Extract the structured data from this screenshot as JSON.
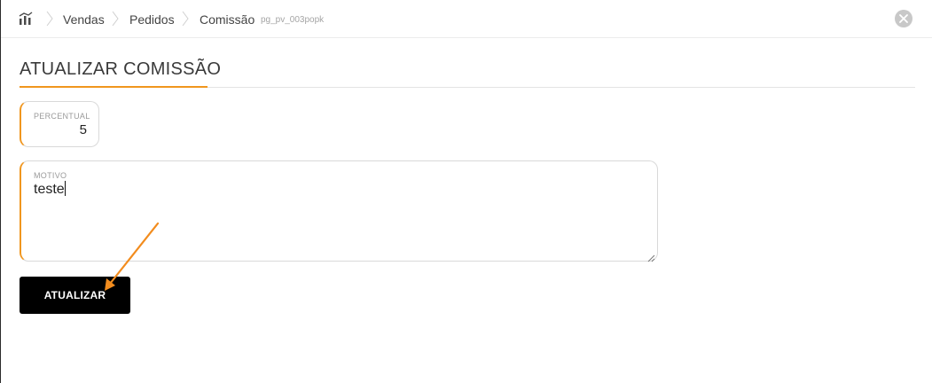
{
  "breadcrumb": {
    "home_icon": "chart-bars-icon",
    "items": [
      "Vendas",
      "Pedidos",
      "Comissão"
    ],
    "code": "pg_pv_003popk"
  },
  "close_icon": "close-icon",
  "section": {
    "title": "ATUALIZAR COMISSÃO"
  },
  "form": {
    "percentual": {
      "label": "PERCENTUAL",
      "value": "5"
    },
    "motivo": {
      "label": "MOTIVO",
      "value": "teste"
    },
    "submit_label": "ATUALIZAR"
  },
  "colors": {
    "accent": "#f0961e",
    "button_bg": "#000000",
    "arrow": "#f28c1e"
  }
}
